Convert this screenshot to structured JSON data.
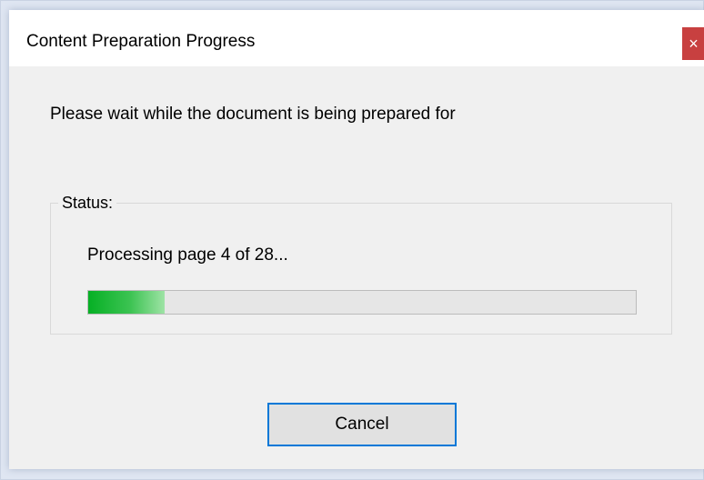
{
  "window": {
    "title": "Content Preparation Progress",
    "close_glyph": "×"
  },
  "message": "Please wait while the document is being prepared for",
  "status": {
    "label": "Status:",
    "text": "Processing page 4 of 28...",
    "progress_fraction": 0.14
  },
  "buttons": {
    "cancel_label": "Cancel"
  },
  "colors": {
    "accent": "#0078d7",
    "progress": "#06b025",
    "close": "#c84040"
  }
}
